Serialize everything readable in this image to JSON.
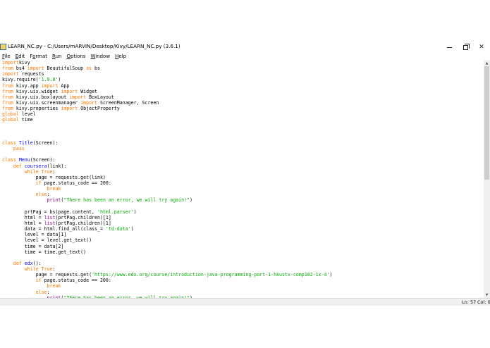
{
  "window": {
    "title": "LEARN_NC.py - C:/Users/mARVIN/Desktop/Kivy/LEARN_NC.py (3.6.1)",
    "controls": {
      "minimize": "minimize-icon",
      "maximize": "maximize-icon",
      "close": "close-icon"
    }
  },
  "menu": [
    {
      "u": "F",
      "rest": "ile"
    },
    {
      "u": "E",
      "rest": "dit"
    },
    {
      "pre": "F",
      "u": "o",
      "rest": "rmat"
    },
    {
      "u": "R",
      "rest": "un"
    },
    {
      "u": "O",
      "rest": "ptions"
    },
    {
      "u": "W",
      "rest": "indow"
    },
    {
      "u": "H",
      "rest": "elp"
    }
  ],
  "colors": {
    "keyword": "#ff7700",
    "builtin": "#900090",
    "string": "#00aa00",
    "definition": "#0000ff"
  },
  "code_lines": [
    [
      [
        "kw",
        "import"
      ],
      [
        "",
        "kivy"
      ]
    ],
    [
      [
        "kw",
        "from"
      ],
      [
        "",
        " bs4 "
      ],
      [
        "kw",
        "import"
      ],
      [
        "",
        " BeautifulSoup "
      ],
      [
        "kw",
        "as"
      ],
      [
        "",
        " bs"
      ]
    ],
    [
      [
        "kw",
        "import"
      ],
      [
        "",
        " requests"
      ]
    ],
    [
      [
        "",
        "kivy.require("
      ],
      [
        "st",
        "'1.9.0'"
      ],
      [
        "",
        ")"
      ]
    ],
    [
      [
        "kw",
        "from"
      ],
      [
        "",
        " kivy.app "
      ],
      [
        "kw",
        "import"
      ],
      [
        "",
        " App"
      ]
    ],
    [
      [
        "kw",
        "from"
      ],
      [
        "",
        " kivy.uix.widget "
      ],
      [
        "kw",
        "import"
      ],
      [
        "",
        " Widget"
      ]
    ],
    [
      [
        "kw",
        "from"
      ],
      [
        "",
        " kivy.uix.boxlayout "
      ],
      [
        "kw",
        "import"
      ],
      [
        "",
        " BoxLayout"
      ]
    ],
    [
      [
        "kw",
        "from"
      ],
      [
        "",
        " kivy.uix.screenmanager "
      ],
      [
        "kw",
        "import"
      ],
      [
        "",
        " ScreenManager, Screen"
      ]
    ],
    [
      [
        "kw",
        "from"
      ],
      [
        "",
        " kivy.properties "
      ],
      [
        "kw",
        "import"
      ],
      [
        "",
        " ObjectProperty"
      ]
    ],
    [
      [
        "kw",
        "global"
      ],
      [
        "",
        " level"
      ]
    ],
    [
      [
        "kw",
        "global"
      ],
      [
        "",
        " time"
      ]
    ],
    [],
    [],
    [],
    [
      [
        "kw",
        "class"
      ],
      [
        "",
        " "
      ],
      [
        "df",
        "Title"
      ],
      [
        "",
        "(Screen):"
      ]
    ],
    [
      [
        "",
        "    "
      ],
      [
        "kw",
        "pass"
      ]
    ],
    [],
    [
      [
        "kw",
        "class"
      ],
      [
        "",
        " "
      ],
      [
        "df",
        "Menu"
      ],
      [
        "",
        "(Screen):"
      ]
    ],
    [
      [
        "",
        "    "
      ],
      [
        "kw",
        "def"
      ],
      [
        "",
        " "
      ],
      [
        "df",
        "coursera"
      ],
      [
        "",
        "(link):"
      ]
    ],
    [
      [
        "",
        "        "
      ],
      [
        "kw",
        "while"
      ],
      [
        "",
        " "
      ],
      [
        "kw",
        "True"
      ],
      [
        "",
        ":"
      ]
    ],
    [
      [
        "",
        "            page = requests.get(link)"
      ]
    ],
    [
      [
        "",
        "            "
      ],
      [
        "kw",
        "if"
      ],
      [
        "",
        " page.status_code == 200:"
      ]
    ],
    [
      [
        "",
        "                "
      ],
      [
        "kw",
        "break"
      ]
    ],
    [
      [
        "",
        "            "
      ],
      [
        "kw",
        "else"
      ],
      [
        "",
        ":"
      ]
    ],
    [
      [
        "",
        "                "
      ],
      [
        "bi",
        "print"
      ],
      [
        "",
        "("
      ],
      [
        "st",
        "\"There has been an error, we will try again!\""
      ],
      [
        "",
        ")"
      ]
    ],
    [],
    [
      [
        "",
        "        prtPag = bs(page.content, "
      ],
      [
        "st",
        "'html.parser'"
      ],
      [
        "",
        ")"
      ]
    ],
    [
      [
        "",
        "        html = "
      ],
      [
        "bi",
        "list"
      ],
      [
        "",
        "(prtPag.children)[1]"
      ]
    ],
    [
      [
        "",
        "        html = "
      ],
      [
        "bi",
        "list"
      ],
      [
        "",
        "(prtPag.children)[1]"
      ]
    ],
    [
      [
        "",
        "        data = html.find_all(class_= "
      ],
      [
        "st",
        "'td-data'"
      ],
      [
        "",
        ")"
      ]
    ],
    [
      [
        "",
        "        level = data[1]"
      ]
    ],
    [
      [
        "",
        "        level = level.get_text()"
      ]
    ],
    [
      [
        "",
        "        time = data[2]"
      ]
    ],
    [
      [
        "",
        "        time = time.get_text()"
      ]
    ],
    [],
    [
      [
        "",
        "    "
      ],
      [
        "kw",
        "def"
      ],
      [
        "",
        " "
      ],
      [
        "df",
        "edx"
      ],
      [
        "",
        "():"
      ]
    ],
    [
      [
        "",
        "        "
      ],
      [
        "kw",
        "while"
      ],
      [
        "",
        " "
      ],
      [
        "kw",
        "True"
      ],
      [
        "",
        ":"
      ]
    ],
    [
      [
        "",
        "            page = requests.get("
      ],
      [
        "st",
        "'https://www.edx.org/course/introduction-java-programming-part-1-hkustx-comp102-1x-4'"
      ],
      [
        "",
        ")"
      ]
    ],
    [
      [
        "",
        "            "
      ],
      [
        "kw",
        "if"
      ],
      [
        "",
        " page.status_code == 200:"
      ]
    ],
    [
      [
        "",
        "                "
      ],
      [
        "kw",
        "break"
      ]
    ],
    [
      [
        "",
        "            "
      ],
      [
        "kw",
        "else"
      ],
      [
        "",
        ":"
      ]
    ],
    [
      [
        "",
        "                "
      ],
      [
        "bi",
        "print"
      ],
      [
        "",
        "("
      ],
      [
        "st",
        "\"There has been an error, we will try again!\""
      ],
      [
        "",
        ")"
      ]
    ]
  ],
  "status": {
    "line": "Ln: 57",
    "col": "Col: 0"
  },
  "scrollbar": {
    "up_icon": "scroll-up-arrow-icon",
    "down_icon": "scroll-down-arrow-icon"
  }
}
